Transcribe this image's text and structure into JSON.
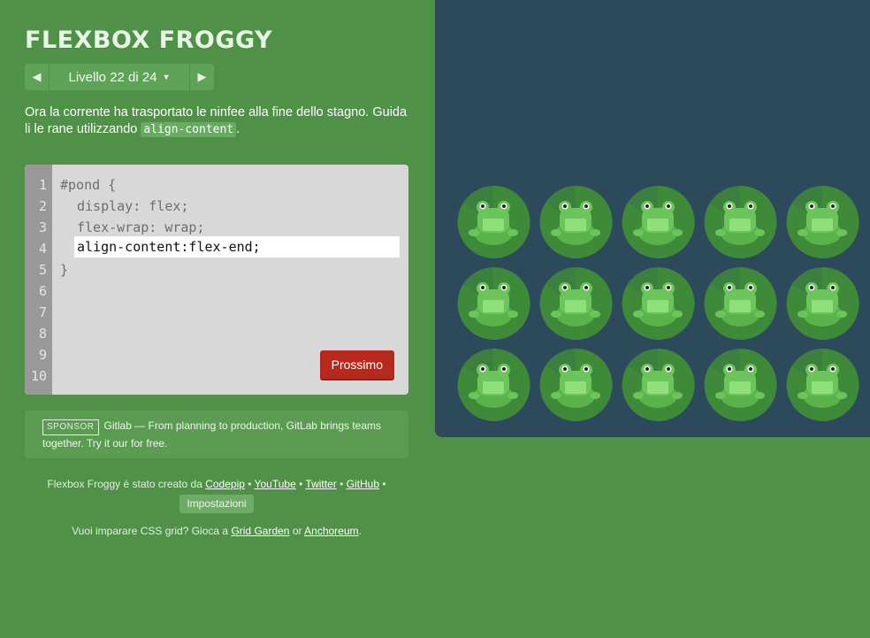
{
  "app": {
    "title": "FLEXBOX FROGGY"
  },
  "level_nav": {
    "prev_icon": "triangle-left-icon",
    "label": "Livello 22 di 24",
    "next_icon": "triangle-right-icon"
  },
  "instructions": {
    "text_before": "Ora la corrente ha trasportato le ninfee alla fine dello stagno. Guida li le rane utilizzando ",
    "code": "align-content",
    "text_after": "."
  },
  "editor": {
    "line_numbers": [
      "1",
      "2",
      "3",
      "4",
      "5",
      "6",
      "7",
      "8",
      "9",
      "10"
    ],
    "lines": [
      "#pond {",
      "display: flex;",
      "flex-wrap: wrap;",
      "",
      "}"
    ],
    "input_value": "align-content:flex-end;",
    "next_label": "Prossimo"
  },
  "sponsor": {
    "badge": "SPONSOR",
    "text": "Gitlab — From planning to production, GitLab brings teams together. Try it our for free."
  },
  "footer": {
    "credit": "Flexbox Froggy è stato creato da",
    "links": [
      "Codepip",
      "YouTube",
      "Twitter",
      "GitHub"
    ],
    "separator": "•",
    "settings_label": "Impostazioni",
    "grid_text": "Vuoi imparare CSS grid? Gioca a",
    "grid_link1": "Grid Garden",
    "or_text": "or",
    "grid_link2": "Anchoreum",
    "end_period": "."
  },
  "pond": {
    "background": "#2c4a5c",
    "frog_count": 15,
    "pad_color": "#3e8a38",
    "frog_color": "#8fe07a"
  }
}
